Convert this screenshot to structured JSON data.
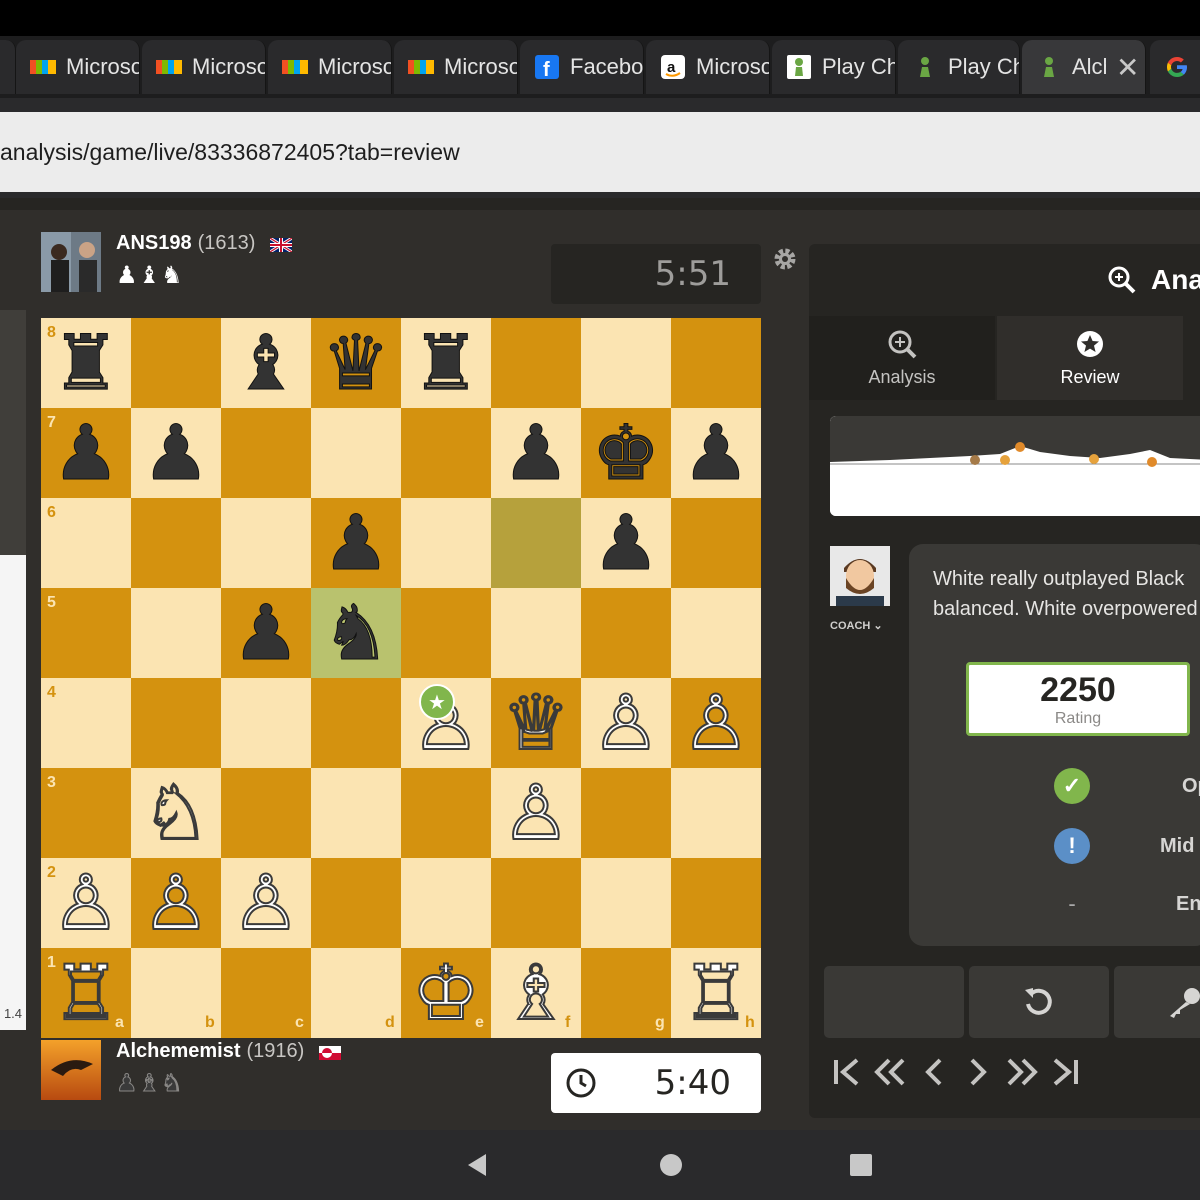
{
  "tabs": [
    {
      "label": "Microsoft",
      "icon": "microsoft-icon"
    },
    {
      "label": "Microsoft",
      "icon": "microsoft-icon"
    },
    {
      "label": "Microsoft",
      "icon": "microsoft-icon"
    },
    {
      "label": "Microsoft",
      "icon": "microsoft-icon"
    },
    {
      "label": "Facebook",
      "icon": "facebook-icon"
    },
    {
      "label": "Microsoft",
      "icon": "amazon-icon"
    },
    {
      "label": "Play Chess",
      "icon": "chess-pawn-icon"
    },
    {
      "label": "Play Chess",
      "icon": "chess-pawn-icon"
    },
    {
      "label": "Alchemist",
      "icon": "chess-pawn-icon"
    }
  ],
  "url": "analysis/game/live/83336872405?tab=review",
  "top_player": {
    "name": "ANS198",
    "rating": "(1613)",
    "flag": "uk-flag",
    "captured": "♟♝♞",
    "clock": "5:51"
  },
  "bottom_player": {
    "name": "Alchememist",
    "rating": "(1916)",
    "flag": "greenland-flag",
    "captured": "♟♝♞",
    "clock": "5:40"
  },
  "eval_label": "1.4",
  "board": {
    "ranks": [
      "8",
      "7",
      "6",
      "5",
      "4",
      "3",
      "2",
      "1"
    ],
    "files": [
      "a",
      "b",
      "c",
      "d",
      "e",
      "f",
      "g",
      "h"
    ],
    "pieces": [
      {
        "sq": "a8",
        "glyph": "♜",
        "color": "b"
      },
      {
        "sq": "c8",
        "glyph": "♝",
        "color": "b"
      },
      {
        "sq": "d8",
        "glyph": "♛",
        "color": "b"
      },
      {
        "sq": "e8",
        "glyph": "♜",
        "color": "b"
      },
      {
        "sq": "a7",
        "glyph": "♟",
        "color": "b"
      },
      {
        "sq": "b7",
        "glyph": "♟",
        "color": "b"
      },
      {
        "sq": "f7",
        "glyph": "♟",
        "color": "b"
      },
      {
        "sq": "g7",
        "glyph": "♚",
        "color": "b"
      },
      {
        "sq": "h7",
        "glyph": "♟",
        "color": "b"
      },
      {
        "sq": "d6",
        "glyph": "♟",
        "color": "b"
      },
      {
        "sq": "g6",
        "glyph": "♟",
        "color": "b"
      },
      {
        "sq": "c5",
        "glyph": "♟",
        "color": "b"
      },
      {
        "sq": "d5",
        "glyph": "♞",
        "color": "b"
      },
      {
        "sq": "e4",
        "glyph": "♙",
        "color": "w"
      },
      {
        "sq": "f4",
        "glyph": "♕",
        "color": "w"
      },
      {
        "sq": "g4",
        "glyph": "♙",
        "color": "w"
      },
      {
        "sq": "h4",
        "glyph": "♙",
        "color": "w"
      },
      {
        "sq": "b3",
        "glyph": "♘",
        "color": "w"
      },
      {
        "sq": "f3",
        "glyph": "♙",
        "color": "w"
      },
      {
        "sq": "a2",
        "glyph": "♙",
        "color": "w"
      },
      {
        "sq": "b2",
        "glyph": "♙",
        "color": "w"
      },
      {
        "sq": "c2",
        "glyph": "♙",
        "color": "w"
      },
      {
        "sq": "a1",
        "glyph": "♖",
        "color": "w"
      },
      {
        "sq": "e1",
        "glyph": "♔",
        "color": "w"
      },
      {
        "sq": "f1",
        "glyph": "♗",
        "color": "w"
      },
      {
        "sq": "h1",
        "glyph": "♖",
        "color": "w"
      }
    ],
    "highlight_from": "f6",
    "highlight_to": "d5"
  },
  "panel": {
    "title": "Ana",
    "tabs": [
      {
        "label": "Analysis"
      },
      {
        "label": "Review"
      }
    ],
    "coach_label": "COACH ⌄",
    "message_line1": "White really outplayed Black",
    "message_line2": "balanced. White overpowered",
    "rating_value": "2250",
    "rating_label": "Rating",
    "phases": [
      {
        "label": "Op",
        "icon": "check-icon",
        "color": "#81b64c"
      },
      {
        "label": "Mid",
        "icon": "inaccuracy-icon",
        "color": "#5b8fc7"
      },
      {
        "label": "En",
        "icon": "dash",
        "symbol": "-"
      }
    ]
  },
  "colors": {
    "light_square": "#fbe4b2",
    "dark_square": "#d4920f",
    "accent_green": "#81b64c"
  }
}
